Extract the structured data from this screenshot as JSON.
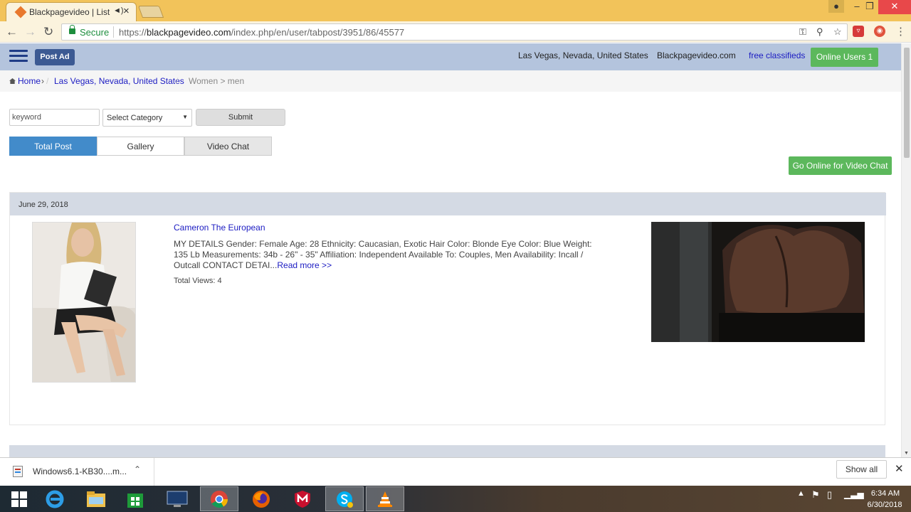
{
  "browser": {
    "tab_title": "Blackpagevideo | List",
    "url_secure": "Secure",
    "url_scheme": "https://",
    "url_host": "blackpagevideo.com",
    "url_path": "/index.php/en/user/tabpost/3951/86/45577"
  },
  "header": {
    "post_ad": "Post Ad",
    "location": "Las Vegas, Nevada, United States",
    "site": "Blackpagevideo.com",
    "free": "free classifieds",
    "online_users": "Online Users 1"
  },
  "breadcrumb": {
    "home": "Home",
    "location": "Las Vegas, Nevada, United States",
    "current": "Women > men"
  },
  "search": {
    "placeholder": "keyword",
    "category": "Select Category",
    "submit": "Submit"
  },
  "tabs": [
    "Total Post",
    "Gallery",
    "Video Chat"
  ],
  "go_online": "Go Online for Video Chat",
  "post": {
    "date": "June 29, 2018",
    "title": "Cameron The European",
    "description": "MY DETAILS Gender: Female Age: 28 Ethnicity: Caucasian, Exotic Hair Color: Blonde Eye Color: Blue Weight: 135 Lb Measurements: 34b - 26\" - 35\" Affiliation: Independent Available To: Couples, Men Availability: Incall / Outcall CONTACT DETAI...",
    "read_more": "Read more >>",
    "views": "Total Views: 4"
  },
  "download": {
    "file": "Windows6.1-KB30....m...",
    "show_all": "Show all"
  },
  "clock": {
    "time": "6:34 AM",
    "date": "6/30/2018"
  }
}
